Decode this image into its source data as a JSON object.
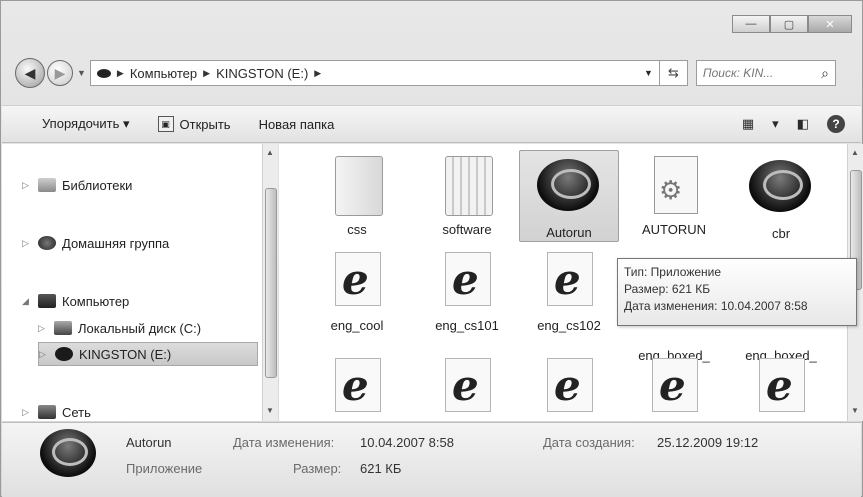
{
  "window": {
    "caption_buttons": [
      "—",
      "▢",
      "✕"
    ]
  },
  "address": {
    "crumbs": [
      "Компьютер",
      "KINGSTON (E:)"
    ],
    "search_placeholder": "Поиск: KIN..."
  },
  "toolbar": {
    "organize_label": "Упорядочить ▾",
    "open_label": "Открыть",
    "new_folder_label": "Новая папка"
  },
  "nav": {
    "libraries": "Библиотеки",
    "homegroup": "Домашняя группа",
    "computer": "Компьютер",
    "local_disk": "Локальный диск (C:)",
    "kingston": "KINGSTON (E:)",
    "network": "Сеть"
  },
  "files": [
    {
      "name": "css",
      "type": "folder"
    },
    {
      "name": "software",
      "type": "folder"
    },
    {
      "name": "Autorun",
      "type": "app"
    },
    {
      "name": "AUTORUN",
      "type": "ini"
    },
    {
      "name": "cbr",
      "type": "app"
    },
    {
      "name": "eng_cool",
      "type": "html"
    },
    {
      "name": "eng_cs101",
      "type": "html"
    },
    {
      "name": "eng_cs102",
      "type": "html"
    },
    {
      "name": "eng_boxed_blue",
      "display": "eng_boxed_\nblue",
      "type": "html"
    },
    {
      "name": "eng_boxed_yellow",
      "display": "eng_boxed_\nyellow",
      "type": "html"
    }
  ],
  "tooltip": {
    "line1": "Тип: Приложение",
    "line2": "Размер: 621 КБ",
    "line3": "Дата изменения: 10.04.2007 8:58"
  },
  "details": {
    "name": "Autorun",
    "type": "Приложение",
    "modified_label": "Дата изменения:",
    "modified_value": "10.04.2007 8:58",
    "size_label": "Размер:",
    "size_value": "621 КБ",
    "created_label": "Дата создания:",
    "created_value": "25.12.2009 19:12"
  }
}
